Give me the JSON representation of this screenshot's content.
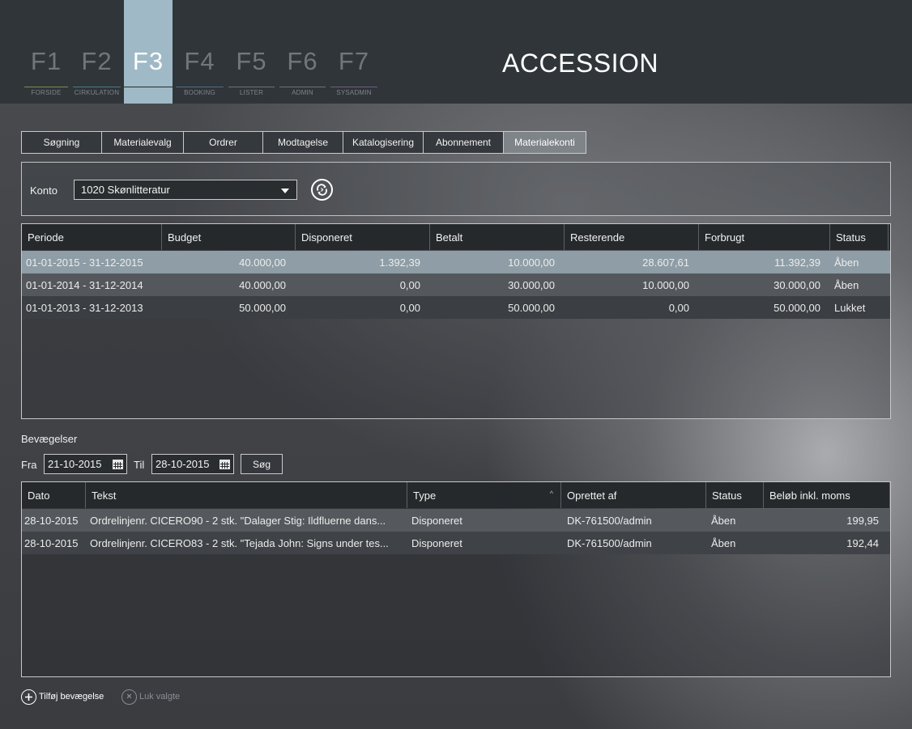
{
  "header": {
    "app_title": "ACCESSION",
    "fkeys": [
      {
        "key": "F1",
        "label": "FORSIDE",
        "color": "#7b8d4a"
      },
      {
        "key": "F2",
        "label": "CIRKULATION",
        "color": "#4d7a86"
      },
      {
        "key": "F3",
        "label": "",
        "color": "#9fb9c6",
        "active": true
      },
      {
        "key": "F4",
        "label": "BOOKING",
        "color": "#4a6e8a"
      },
      {
        "key": "F5",
        "label": "LISTER",
        "color": "#6f7379"
      },
      {
        "key": "F6",
        "label": "ADMIN",
        "color": "#6f7379"
      },
      {
        "key": "F7",
        "label": "SYSADMIN",
        "color": "#6a5d86"
      }
    ]
  },
  "tabs": [
    "Søgning",
    "Materialevalg",
    "Ordrer",
    "Modtagelse",
    "Katalogisering",
    "Abonnement",
    "Materialekonti"
  ],
  "active_tab": "Materialekonti",
  "konto": {
    "label": "Konto",
    "selected": "1020 Skønlitteratur",
    "refresh_icon": "refresh-icon"
  },
  "periods": {
    "columns": [
      "Periode",
      "Budget",
      "Disponeret",
      "Betalt",
      "Resterende",
      "Forbrugt",
      "Status"
    ],
    "rows": [
      [
        "01-01-2015 - 31-12-2015",
        "40.000,00",
        "1.392,39",
        "10.000,00",
        "28.607,61",
        "11.392,39",
        "Åben"
      ],
      [
        "01-01-2014 - 31-12-2014",
        "40.000,00",
        "0,00",
        "30.000,00",
        "10.000,00",
        "30.000,00",
        "Åben"
      ],
      [
        "01-01-2013 - 31-12-2013",
        "50.000,00",
        "0,00",
        "50.000,00",
        "0,00",
        "50.000,00",
        "Lukket"
      ]
    ]
  },
  "movements": {
    "title": "Bevægelser",
    "from_label": "Fra",
    "from_value": "21-10-2015",
    "to_label": "Til",
    "to_value": "28-10-2015",
    "search_label": "Søg",
    "columns": [
      "Dato",
      "Tekst",
      "Type",
      "Oprettet af",
      "Status",
      "Beløb inkl. moms"
    ],
    "sort_indicator": "^",
    "rows": [
      [
        "28-10-2015",
        "Ordrelinjenr. CICERO90 - 2 stk. \"Dalager Stig: Ildfluerne dans...",
        "Disponeret",
        "DK-761500/admin",
        "Åben",
        "199,95"
      ],
      [
        "28-10-2015",
        "Ordrelinjenr. CICERO83 - 2 stk. \"Tejada John: Signs under tes...",
        "Disponeret",
        "DK-761500/admin",
        "Åben",
        "192,44"
      ]
    ]
  },
  "actions": {
    "add_label": "Tilføj bevægelse",
    "add_icon": "plus",
    "close_label": "Luk valgte",
    "close_icon": "×"
  }
}
